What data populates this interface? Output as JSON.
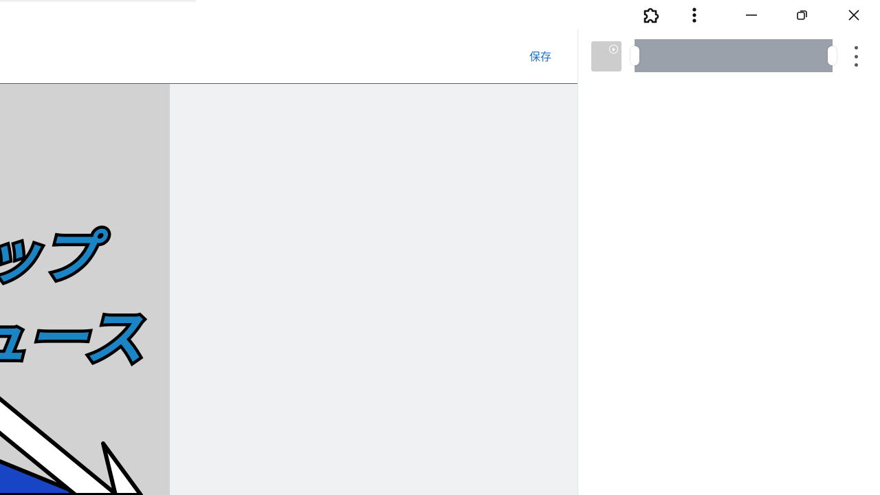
{
  "window": {
    "extensions_icon": "puzzle-icon",
    "more_icon": "more-vert-icon",
    "minimize_icon": "minimize-icon",
    "restore_icon": "restore-icon",
    "close_icon": "close-icon"
  },
  "editor": {
    "save_label": "保存",
    "canvas_text_line1": "ップ",
    "canvas_text_line2": "ュース",
    "accent_color": "#1a73c9"
  },
  "right_panel": {
    "thumbnail_icon": "play-circle-icon",
    "more_icon": "more-vert-icon"
  }
}
